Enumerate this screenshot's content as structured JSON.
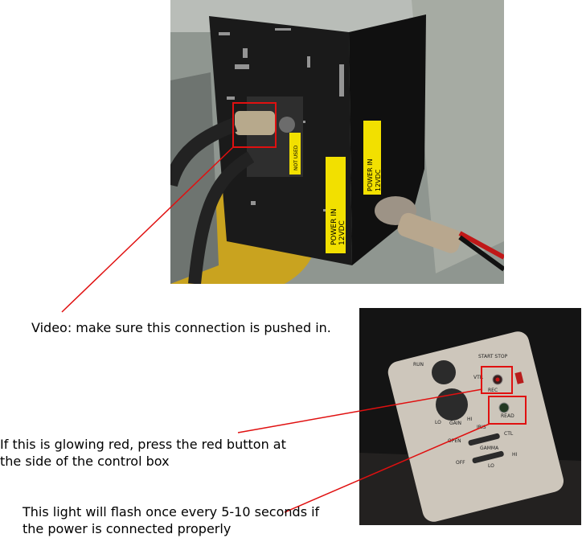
{
  "photos": {
    "camera_box": {
      "labels": {
        "not_used": "NOT USED",
        "power_front": "POWER IN\n12VDC",
        "power_side": "POWER IN\n12VDC"
      }
    },
    "control_box": {
      "labels": {
        "start_stop": "START\nSTOP",
        "run": "RUN",
        "vtr": "VTR",
        "rec": "REC",
        "read": "READ",
        "lo": "LO",
        "gain": "GAIN",
        "hi": "HI",
        "iris": "IRIS",
        "open": "OPEN",
        "ctl": "CTL",
        "gamma": "GAMMA",
        "off": "OFF",
        "gamma_hi": "HI",
        "gamma_lo": "LO"
      }
    }
  },
  "annotations": {
    "video": "Video: make sure this connection is pushed in.",
    "glowing_red": "If this is glowing red, press the red button at the side of the control box",
    "flash_light": "This light will flash once every 5-10 seconds if the power is connected properly"
  },
  "colors": {
    "highlight": "#e01010",
    "box_body": "#1a1a1a",
    "label_yellow": "#f2e000",
    "remote_body": "#cdc6bb"
  }
}
